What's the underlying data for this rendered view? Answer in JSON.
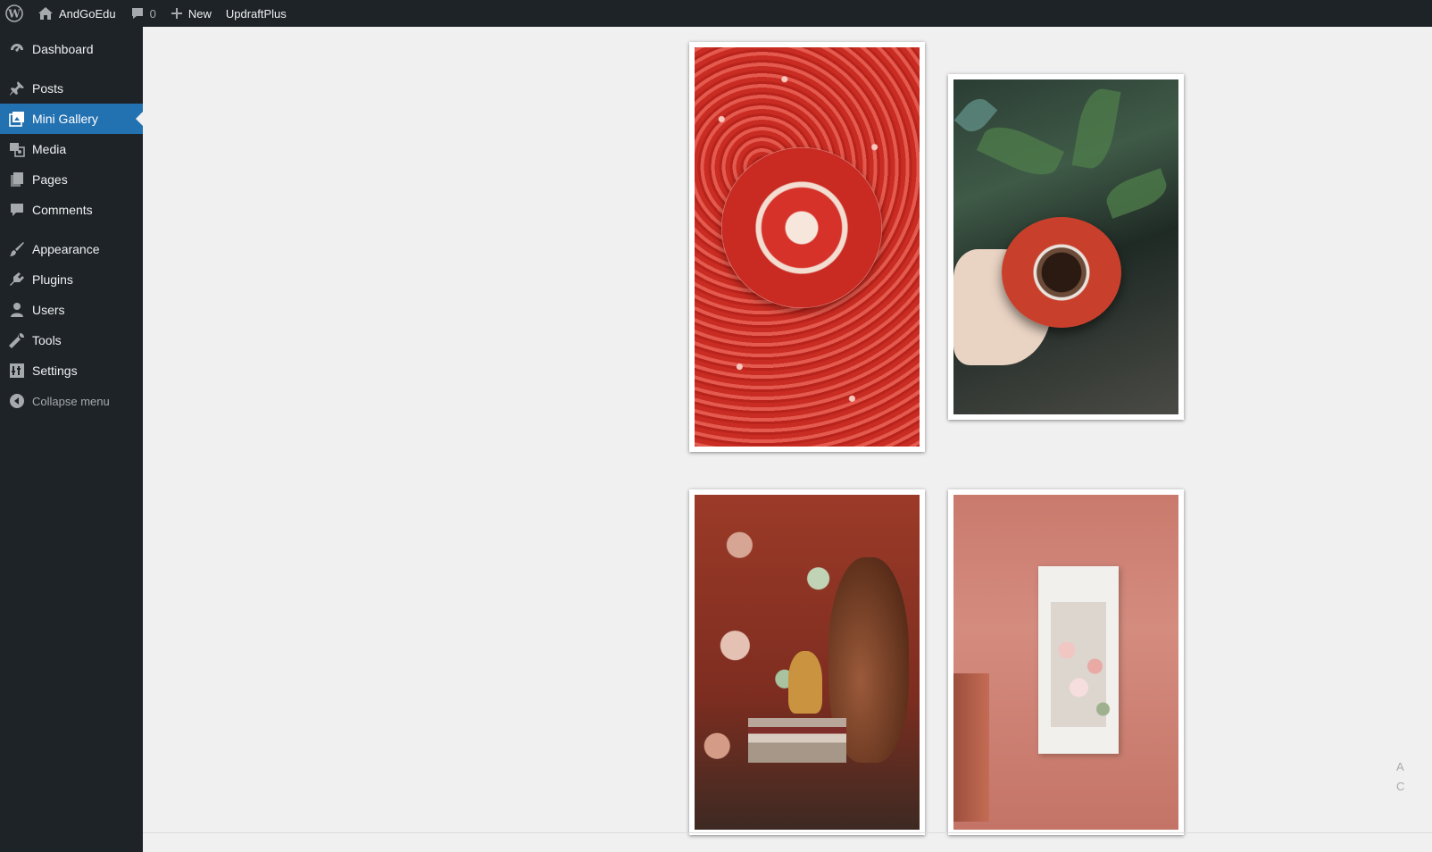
{
  "admin_bar": {
    "wp_logo": "wordpress-logo-icon",
    "site_name": "AndGoEdu",
    "comments_count": "0",
    "new_label": "New",
    "plugin_label": "UpdraftPlus"
  },
  "sidebar": {
    "items": [
      {
        "label": "Dashboard",
        "icon": "dashboard-icon"
      },
      {
        "label": "Posts",
        "icon": "pushpin-icon"
      },
      {
        "label": "Mini Gallery",
        "icon": "gallery-icon",
        "active": true
      },
      {
        "label": "Media",
        "icon": "media-icon"
      },
      {
        "label": "Pages",
        "icon": "pages-icon"
      },
      {
        "label": "Comments",
        "icon": "comment-icon"
      },
      {
        "label": "Appearance",
        "icon": "paintbrush-icon"
      },
      {
        "label": "Plugins",
        "icon": "plugin-icon"
      },
      {
        "label": "Users",
        "icon": "user-icon"
      },
      {
        "label": "Tools",
        "icon": "wrench-icon"
      },
      {
        "label": "Settings",
        "icon": "settings-icon"
      },
      {
        "label": "Collapse menu",
        "icon": "collapse-icon"
      }
    ]
  },
  "gallery": {
    "photos": [
      {
        "subject": "pomegranate"
      },
      {
        "subject": "coffee-cup"
      },
      {
        "subject": "violin"
      },
      {
        "subject": "window-flowers"
      }
    ]
  },
  "cut_text": {
    "line1": "A",
    "line2": "C"
  },
  "colors": {
    "adminbar_bg": "#1d2327",
    "sidebar_bg": "#1d2327",
    "active_bg": "#2271b1",
    "content_bg": "#f0f0f1"
  }
}
